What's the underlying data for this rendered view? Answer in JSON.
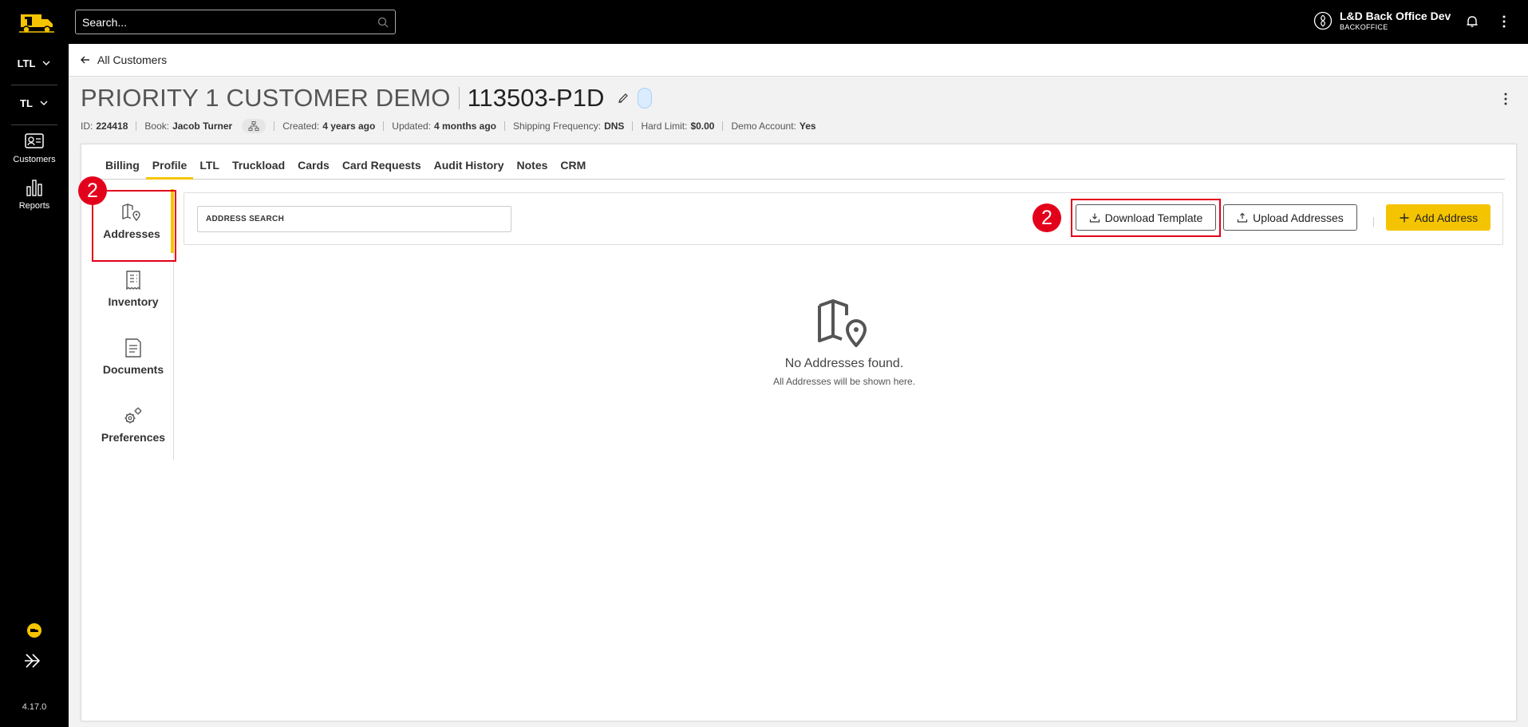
{
  "sidebar": {
    "menus": [
      {
        "label": "LTL"
      },
      {
        "label": "TL"
      }
    ],
    "nav": [
      {
        "label": "Customers",
        "icon": "id-card-icon"
      },
      {
        "label": "Reports",
        "icon": "bar-chart-icon"
      }
    ],
    "version": "4.17.0"
  },
  "topbar": {
    "search_placeholder": "Search...",
    "user_name": "L&D Back Office Dev",
    "user_role": "BACKOFFICE"
  },
  "breadcrumb": {
    "back_label": "All Customers"
  },
  "customer": {
    "name": "PRIORITY 1 CUSTOMER DEMO",
    "code": "113503-P1D",
    "meta": {
      "id_label": "ID:",
      "id_value": "224418",
      "book_label": "Book:",
      "book_value": "Jacob Turner",
      "created_label": "Created:",
      "created_value": "4 years ago",
      "updated_label": "Updated:",
      "updated_value": "4 months ago",
      "freq_label": "Shipping Frequency:",
      "freq_value": "DNS",
      "limit_label": "Hard Limit:",
      "limit_value": "$0.00",
      "demo_label": "Demo Account:",
      "demo_value": "Yes"
    }
  },
  "tabs": [
    {
      "label": "Billing"
    },
    {
      "label": "Profile",
      "active": true
    },
    {
      "label": "LTL"
    },
    {
      "label": "Truckload"
    },
    {
      "label": "Cards"
    },
    {
      "label": "Card Requests"
    },
    {
      "label": "Audit History"
    },
    {
      "label": "Notes"
    },
    {
      "label": "CRM"
    }
  ],
  "subnav": [
    {
      "label": "Addresses",
      "icon": "map-pin-icon",
      "active": true
    },
    {
      "label": "Inventory",
      "icon": "receipt-icon"
    },
    {
      "label": "Documents",
      "icon": "document-icon"
    },
    {
      "label": "Preferences",
      "icon": "gears-icon"
    }
  ],
  "toolbar": {
    "search_placeholder": "ADDRESS SEARCH",
    "download_label": "Download Template",
    "upload_label": "Upload Addresses",
    "add_label": "Add Address"
  },
  "empty_state": {
    "title": "No Addresses found.",
    "subtitle": "All Addresses will be shown here."
  },
  "annotations": {
    "marker_1": "2",
    "marker_2": "2",
    "highlight_color": "#e3001b"
  },
  "colors": {
    "accent": "#f5c400",
    "sidebar_bg": "#000000"
  }
}
